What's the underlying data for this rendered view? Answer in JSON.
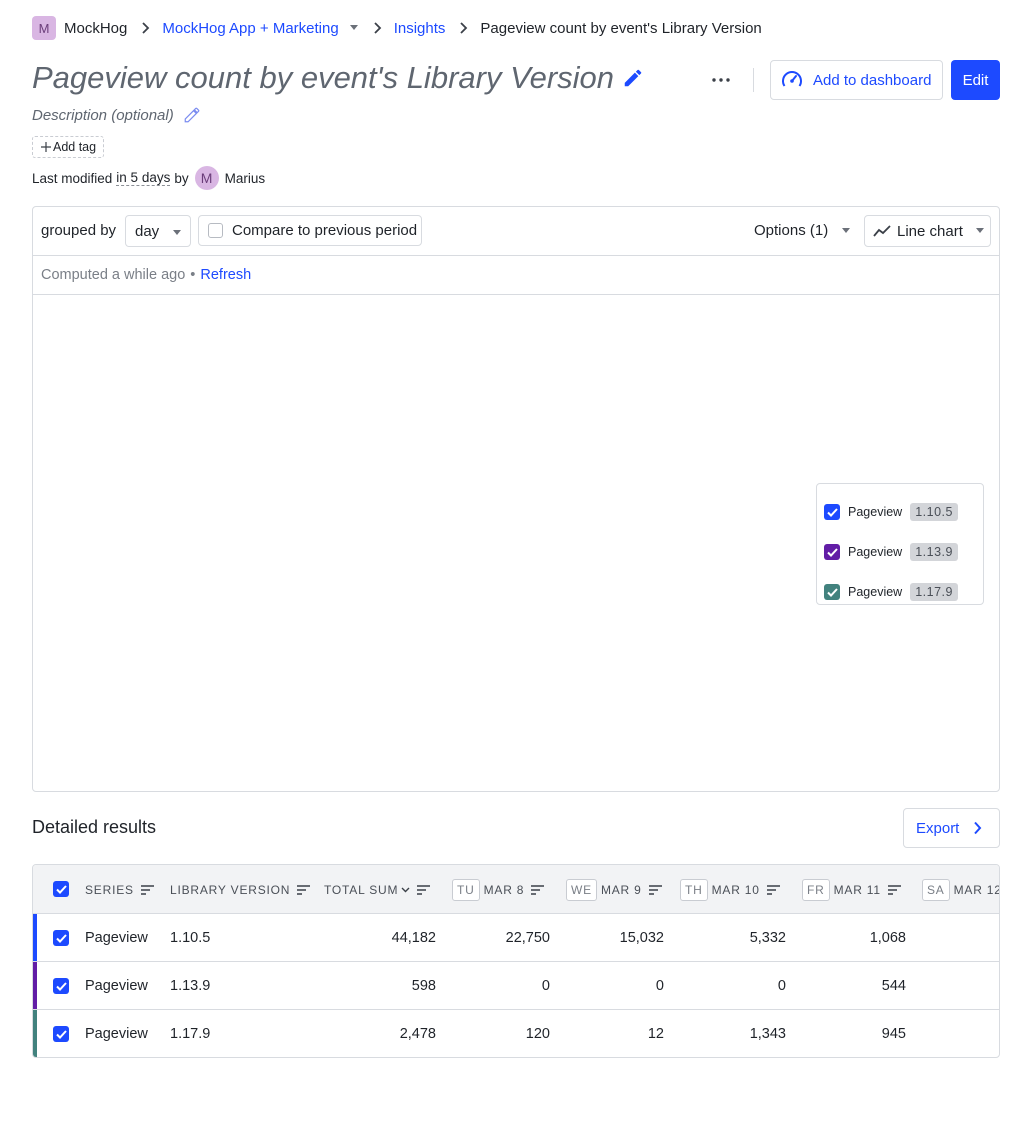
{
  "breadcrumb": {
    "org_initial": "M",
    "org": "MockHog",
    "project": "MockHog App + Marketing",
    "section": "Insights",
    "current": "Pageview count by event's Library Version"
  },
  "insight": {
    "title": "Pageview count by event's Library Version",
    "description_placeholder": "Description (optional)",
    "add_tag": "Add tag",
    "add_to_dashboard": "Add to dashboard",
    "edit": "Edit",
    "modified_prefix": "Last modified",
    "modified_when": "in 5 days",
    "modified_by": "by",
    "author_initial": "M",
    "author": "Marius"
  },
  "toolbar": {
    "grouped_by": "grouped by",
    "interval": "day",
    "compare": "Compare to previous period",
    "options": "Options (1)",
    "chart_type": "Line chart"
  },
  "status": {
    "computed": "Computed a while ago",
    "dot": "•",
    "refresh": "Refresh"
  },
  "legend": [
    {
      "label": "Pageview",
      "version": "1.10.5",
      "color": "#1d4aff"
    },
    {
      "label": "Pageview",
      "version": "1.13.9",
      "color": "#621da6"
    },
    {
      "label": "Pageview",
      "version": "1.17.9",
      "color": "#42827e"
    }
  ],
  "results": {
    "title": "Detailed results",
    "export": "Export",
    "columns": {
      "series": "SERIES",
      "library_version": "LIBRARY VERSION",
      "total_sum": "TOTAL SUM",
      "days": [
        {
          "dow": "TU",
          "date": "MAR 8"
        },
        {
          "dow": "WE",
          "date": "MAR 9"
        },
        {
          "dow": "TH",
          "date": "MAR 10"
        },
        {
          "dow": "FR",
          "date": "MAR 11"
        },
        {
          "dow": "SA",
          "date": "MAR 12"
        }
      ]
    },
    "rows": [
      {
        "series": "Pageview",
        "version": "1.10.5",
        "total": "44,182",
        "d1": "22,750",
        "d2": "15,032",
        "d3": "5,332",
        "d4": "1,068",
        "color": "#1d4aff"
      },
      {
        "series": "Pageview",
        "version": "1.13.9",
        "total": "598",
        "d1": "0",
        "d2": "0",
        "d3": "0",
        "d4": "544",
        "color": "#621da6"
      },
      {
        "series": "Pageview",
        "version": "1.17.9",
        "total": "2,478",
        "d1": "120",
        "d2": "12",
        "d3": "1,343",
        "d4": "945",
        "color": "#42827e"
      }
    ]
  }
}
